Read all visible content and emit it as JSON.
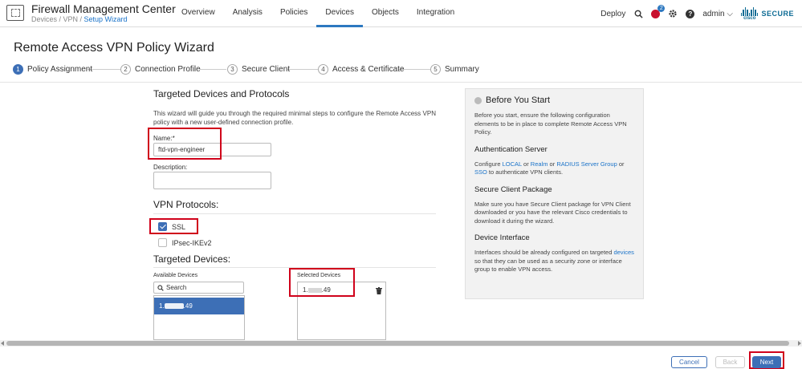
{
  "app": {
    "title": "Firewall Management Center",
    "breadcrumb_prefix": "Devices / VPN / ",
    "breadcrumb_link": "Setup Wizard"
  },
  "nav": {
    "items": [
      "Overview",
      "Analysis",
      "Policies",
      "Devices",
      "Objects",
      "Integration"
    ],
    "active": "Devices"
  },
  "topright": {
    "deploy": "Deploy",
    "alert_count": "2",
    "help": "?",
    "user": "admin ⌵",
    "cisco": "cisco",
    "secure": "SECURE"
  },
  "page": {
    "title": "Remote Access VPN Policy Wizard"
  },
  "steps": [
    {
      "num": "1",
      "label": "Policy Assignment"
    },
    {
      "num": "2",
      "label": "Connection Profile"
    },
    {
      "num": "3",
      "label": "Secure Client"
    },
    {
      "num": "4",
      "label": "Access & Certificate"
    },
    {
      "num": "5",
      "label": "Summary"
    }
  ],
  "form": {
    "section_title": "Targeted Devices and Protocols",
    "intro": "This wizard will guide you through the required minimal steps to configure the Remote Access VPN policy with a new user-defined connection profile.",
    "name_label": "Name:*",
    "name_value": "ftd-vpn-engineer",
    "description_label": "Description:",
    "description_value": "",
    "vpn_protocols_title": "VPN Protocols:",
    "ssl_label": "SSL",
    "ssl_checked": true,
    "ipsec_label": "IPsec-IKEv2",
    "ipsec_checked": false,
    "targeted_devices_title": "Targeted Devices:",
    "available_label": "Available Devices",
    "search_placeholder": "Search",
    "available_item_prefix": "1.",
    "available_item_suffix": ".49",
    "selected_label": "Selected Devices",
    "selected_item_prefix": "1.",
    "selected_item_suffix": ".49"
  },
  "info": {
    "title": "Before You Start",
    "intro": "Before you start, ensure the following configuration elements to be in place to complete Remote Access VPN Policy.",
    "auth_title": "Authentication Server",
    "auth_t1": "Configure ",
    "auth_local": "LOCAL",
    "auth_t2": " or ",
    "auth_realm": "Realm",
    "auth_t3": " or ",
    "auth_radius": "RADIUS Server Group",
    "auth_t4": " or ",
    "auth_sso": "SSO",
    "auth_t5": " to authenticate VPN clients.",
    "client_title": "Secure Client Package",
    "client_text": "Make sure you have Secure Client package for VPN Client downloaded or you have the relevant Cisco credentials to download it during the wizard.",
    "iface_title": "Device Interface",
    "iface_t1": "Interfaces should be already configured on targeted ",
    "iface_link": "devices",
    "iface_t2": " so that they can be used as a security zone or interface group to enable VPN access."
  },
  "footer": {
    "cancel": "Cancel",
    "back": "Back",
    "next": "Next"
  },
  "colors": {
    "accent": "#3d6fb6",
    "highlight_box": "#d0021b",
    "link": "#1a73c9"
  }
}
